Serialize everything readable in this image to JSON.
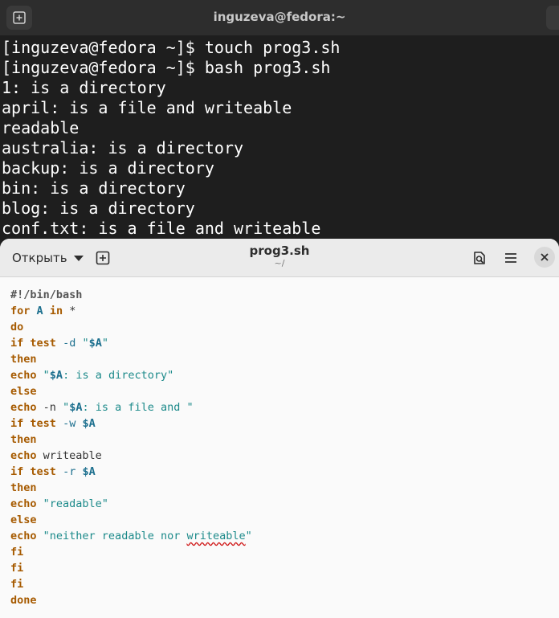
{
  "terminal": {
    "title": "inguzeva@fedora:~",
    "lines": [
      "[inguzeva@fedora ~]$ touch prog3.sh",
      "[inguzeva@fedora ~]$ bash prog3.sh",
      "1: is a directory",
      "april: is a file and writeable",
      "readable",
      "australia: is a directory",
      "backup: is a directory",
      "bin: is a directory",
      "blog: is a directory",
      "conf.txt: is a file and writeable"
    ]
  },
  "editor": {
    "open_label": "Открыть",
    "file_name": "prog3.sh",
    "file_path": "~/",
    "code": {
      "l1": "#!/bin/bash",
      "l2_for": "for",
      "l2_a": "A",
      "l2_in": "in",
      "l2_star": "*",
      "l3": "do",
      "l4_if": "if",
      "l4_test": "test",
      "l4_opt": "-d",
      "l4_q1": "\"",
      "l4_var": "$A",
      "l4_q2": "\"",
      "l5": "then",
      "l6_echo": "echo",
      "l6_q1": "\"",
      "l6_var": "$A",
      "l6_rest": ": is a directory\"",
      "l7": "else",
      "l8_echo": "echo",
      "l8_opt": "-n",
      "l8_q1": "\"",
      "l8_var": "$A",
      "l8_rest": ": is a file and \"",
      "l9_if": "if",
      "l9_test": "test",
      "l9_opt": "-w",
      "l9_var": "$A",
      "l10": "then",
      "l11_echo": "echo",
      "l11_word": "writeable",
      "l12_if": "if",
      "l12_test": "test",
      "l12_opt": "-r",
      "l12_var": "$A",
      "l13": "then",
      "l14_echo": "echo",
      "l14_str": "\"readable\"",
      "l15": "else",
      "l16_echo": "echo",
      "l16_str1": "\"neither readable nor ",
      "l16_miss": "writeable",
      "l16_str2": "\"",
      "l17": "fi",
      "l18": "fi",
      "l19": "fi",
      "l20": "done"
    }
  },
  "icons": {
    "new_tab": "new-tab-icon",
    "open_chevron": "chevron-down-icon",
    "new_document": "new-document-icon",
    "find": "find-icon",
    "menu": "hamburger-menu-icon",
    "close": "close-icon"
  }
}
